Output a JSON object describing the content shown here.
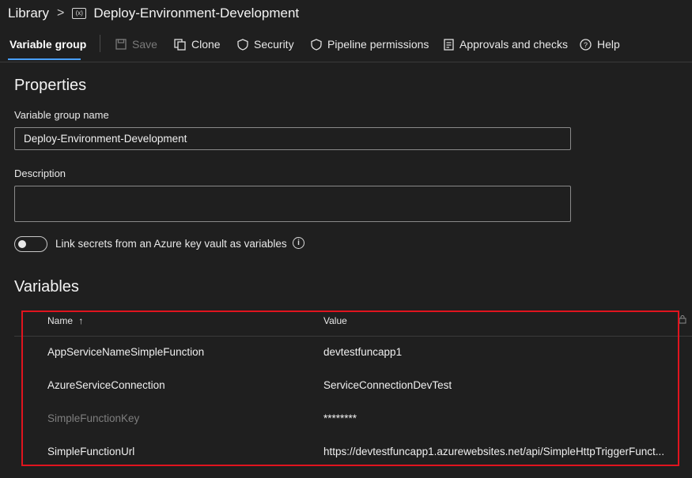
{
  "breadcrumb": {
    "root": "Library",
    "current": "Deploy-Environment-Development",
    "icon": "variable-group-icon"
  },
  "toolbar": {
    "active_tab": "Variable group",
    "save": "Save",
    "clone": "Clone",
    "security": "Security",
    "pipeline_permissions": "Pipeline permissions",
    "approvals": "Approvals and checks",
    "help": "Help"
  },
  "properties": {
    "heading": "Properties",
    "name_label": "Variable group name",
    "name_value": "Deploy-Environment-Development",
    "description_label": "Description",
    "description_value": "",
    "link_secrets_label": "Link secrets from an Azure key vault as variables",
    "link_secrets_on": false
  },
  "variables": {
    "heading": "Variables",
    "columns": {
      "name": "Name",
      "sort": "↑",
      "value": "Value"
    },
    "rows": [
      {
        "name": "AppServiceNameSimpleFunction",
        "value": "devtestfuncapp1",
        "secret": false
      },
      {
        "name": "AzureServiceConnection",
        "value": "ServiceConnectionDevTest",
        "secret": false
      },
      {
        "name": "SimpleFunctionKey",
        "value": "********",
        "secret": true
      },
      {
        "name": "SimpleFunctionUrl",
        "value": "https://devtestfuncapp1.azurewebsites.net/api/SimpleHttpTriggerFunct...",
        "secret": false
      }
    ]
  },
  "colors": {
    "accent": "#4aa0ff",
    "highlight": "#e0141e",
    "background": "#1f1f1f"
  }
}
